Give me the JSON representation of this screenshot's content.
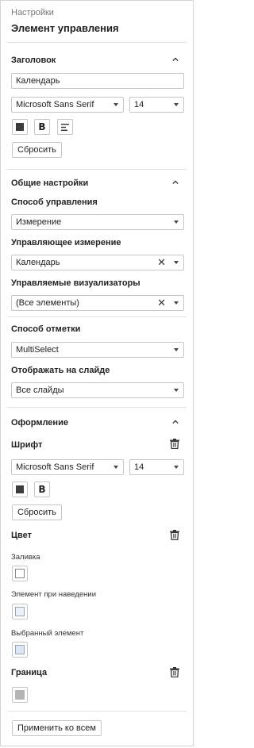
{
  "header": {
    "breadcrumb": "Настройки",
    "title": "Элемент управления"
  },
  "heading_section": {
    "title": "Заголовок",
    "text_value": "Календарь",
    "font": "Microsoft Sans Serif",
    "size": "14",
    "reset_label": "Сбросить"
  },
  "general": {
    "title": "Общие настройки",
    "control_method_label": "Способ управления",
    "control_method_value": "Измерение",
    "control_dimension_label": "Управляющее измерение",
    "control_dimension_value": "Календарь",
    "controlled_visualizers_label": "Управляемые визуализаторы",
    "controlled_visualizers_value": "(Все элементы)",
    "mark_method_label": "Способ отметки",
    "mark_method_value": "MultiSelect",
    "show_on_slide_label": "Отображать на слайде",
    "show_on_slide_value": "Все слайды"
  },
  "appearance": {
    "title": "Оформление",
    "font_label": "Шрифт",
    "font": "Microsoft Sans Serif",
    "size": "14",
    "reset_label": "Сбросить",
    "color_label": "Цвет",
    "fill_label": "Заливка",
    "hover_label": "Элемент при наведении",
    "selected_label": "Выбранный элемент",
    "border_label": "Граница",
    "apply_all_label": "Применить ко всем"
  },
  "colors": {
    "text_color": "#3d3d3d",
    "fill": "#ffffff",
    "hover": "#edf2f9",
    "selected": "#dde6f3",
    "border": "#b5b5b5"
  }
}
